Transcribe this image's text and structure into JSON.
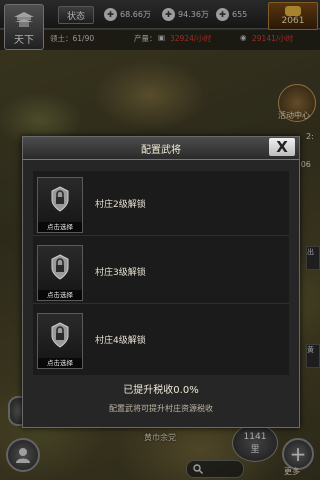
{
  "header": {
    "emblem_label": "天下",
    "status_label": "状态",
    "resources": [
      {
        "icon": "grain-icon",
        "value": "68.66万"
      },
      {
        "icon": "wood-icon",
        "value": "94.36万"
      },
      {
        "icon": "stone-icon",
        "value": "655"
      }
    ],
    "gold": "2061",
    "territory": "领土：61/90",
    "production_label": "产量：",
    "production_a": "32924/小时",
    "production_b": "29141/小时"
  },
  "side": {
    "activity_label": "活动中心",
    "time_a": "2:",
    "time_b": ":06",
    "chip_a": "出",
    "chip_b": "黄"
  },
  "map": {
    "place": "黄巾余党",
    "distance_value": "1141",
    "distance_unit": "里",
    "more_label": "更多"
  },
  "dialog": {
    "title": "配置武将",
    "close": "X",
    "slots": [
      {
        "pick": "点击选择",
        "text": "村庄2级解锁"
      },
      {
        "pick": "点击选择",
        "text": "村庄3级解锁"
      },
      {
        "pick": "点击选择",
        "text": "村庄4级解锁"
      }
    ],
    "tax": "已提升税收0.0%",
    "hint": "配置武将可提升村庄资源税收"
  },
  "colors": {
    "production_red": "#e23b2e",
    "gold_frame": "#b37d33"
  }
}
